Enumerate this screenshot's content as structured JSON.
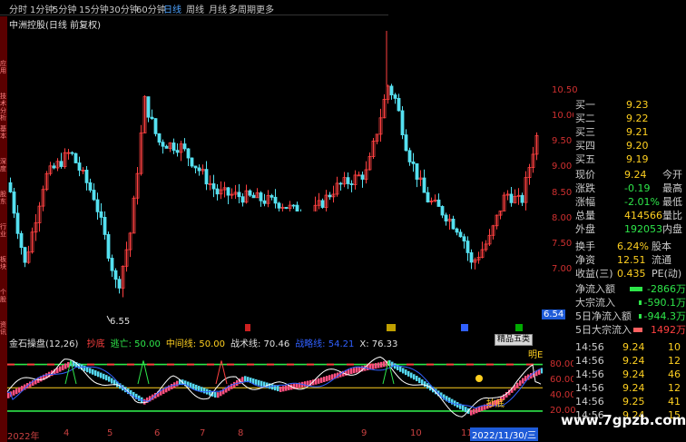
{
  "topbar": {
    "tabs": [
      {
        "label": "分时",
        "active": false
      },
      {
        "label": "1分钟",
        "active": false
      },
      {
        "label": "5分钟",
        "active": false
      },
      {
        "label": "15分钟",
        "active": false
      },
      {
        "label": "30分钟",
        "active": false
      },
      {
        "label": "60分钟",
        "active": false
      },
      {
        "label": "日线",
        "active": true
      },
      {
        "label": "周线",
        "active": false
      },
      {
        "label": "月线",
        "active": false
      },
      {
        "label": "多周期",
        "active": false
      },
      {
        "label": "更多",
        "active": false
      }
    ]
  },
  "sidebar": {
    "items": [
      "应用",
      "技术分析",
      "基本",
      "深度",
      "股东",
      "行业",
      "板块",
      "个股",
      "资讯"
    ]
  },
  "main": {
    "title": "中洲控股(日线 前复权)",
    "low_label": "6.55",
    "price_tag": "6.54",
    "y_ticks": [
      "10.50",
      "10.00",
      "9.50",
      "9.00",
      "8.50",
      "8.00",
      "7.50",
      "7.00"
    ]
  },
  "indicator": {
    "name": "金石操盘(12,26)",
    "items": [
      {
        "label": "抄底",
        "color": "#ff4040"
      },
      {
        "label": "逃亡: 50.00",
        "color": "#2ee64a"
      },
      {
        "label": "中间线: 50.00",
        "color": "#ffd020"
      },
      {
        "label": "战术线: 70.46",
        "color": "#e0e0e0"
      },
      {
        "label": "战略线: 54.21",
        "color": "#3060ff"
      },
      {
        "label": "X: 76.33",
        "color": "#e0e0e0"
      }
    ],
    "y_ticks": [
      "80.00",
      "60.00",
      "40.00",
      "20.00"
    ],
    "button": "精品五类",
    "label_bright": "明E",
    "label_bottom": "抄底"
  },
  "xaxis": {
    "labels": [
      "2022年",
      "4",
      "5",
      "6",
      "7",
      "8",
      "9",
      "10",
      "11"
    ],
    "cursor_date": "2022/11/30/三"
  },
  "quote": {
    "buys": [
      {
        "k": "买一",
        "v": "9.23"
      },
      {
        "k": "买二",
        "v": "9.22"
      },
      {
        "k": "买三",
        "v": "9.21"
      },
      {
        "k": "买四",
        "v": "9.20"
      },
      {
        "k": "买五",
        "v": "9.19"
      }
    ],
    "rows": [
      {
        "k": "现价",
        "v": "9.24",
        "k2": "今开"
      },
      {
        "k": "涨跌",
        "v": "-0.19",
        "k2": "最高"
      },
      {
        "k": "涨幅",
        "v": "-2.01%",
        "k2": "最低"
      },
      {
        "k": "总量",
        "v": "414566",
        "k2": "量比"
      },
      {
        "k": "外盘",
        "v": "192053",
        "k2": "内盘"
      }
    ],
    "rows2": [
      {
        "k": "换手",
        "v": "6.24%",
        "k2": "股本"
      },
      {
        "k": "净资",
        "v": "12.51",
        "k2": "流通"
      },
      {
        "k": "收益(三)",
        "v": "0.435",
        "k2": "PE(动)"
      }
    ],
    "flows": [
      {
        "k": "净流入额",
        "v": "-2866万"
      },
      {
        "k": "大宗流入",
        "v": "-590.1万"
      },
      {
        "k": "5日净流入额",
        "v": "-944.3万"
      },
      {
        "k": "5日大宗流入",
        "v": "1492万"
      }
    ],
    "ticks": [
      {
        "t": "14:56",
        "p": "9.24",
        "n": "10"
      },
      {
        "t": "14:56",
        "p": "9.24",
        "n": "12"
      },
      {
        "t": "14:56",
        "p": "9.24",
        "n": "46"
      },
      {
        "t": "14:56",
        "p": "9.24",
        "n": "12"
      },
      {
        "t": "14:56",
        "p": "9.25",
        "n": "41"
      },
      {
        "t": "14:56",
        "p": "9.24",
        "n": "15"
      }
    ]
  },
  "footer": {
    "site": "www.7gpzb.com"
  }
}
